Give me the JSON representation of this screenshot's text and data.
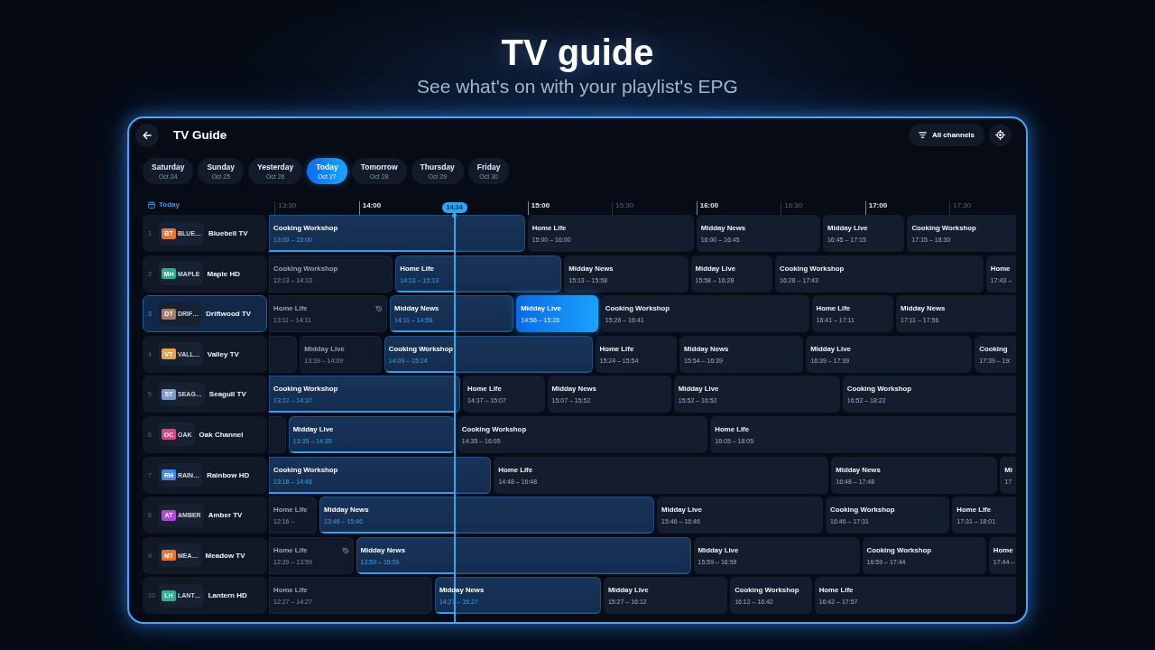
{
  "hero": {
    "title": "TV guide",
    "subtitle": "See what's on with your playlist's EPG"
  },
  "header": {
    "title": "TV Guide",
    "filter_button": "All channels"
  },
  "dates": [
    {
      "day": "Saturday",
      "date": "Oct 24",
      "selected": false
    },
    {
      "day": "Sunday",
      "date": "Oct 25",
      "selected": false
    },
    {
      "day": "Yesterday",
      "date": "Oct 26",
      "selected": false
    },
    {
      "day": "Today",
      "date": "Oct 27",
      "selected": true
    },
    {
      "day": "Tomorrow",
      "date": "Oct 28",
      "selected": false
    },
    {
      "day": "Thursday",
      "date": "Oct 29",
      "selected": false
    },
    {
      "day": "Friday",
      "date": "Oct 30",
      "selected": false
    }
  ],
  "timeline": {
    "day_label": "Today",
    "now": "14:34",
    "ticks": [
      {
        "label": "13:30",
        "kind": "half"
      },
      {
        "label": "14:00",
        "kind": "hour"
      },
      {
        "label": "15:00",
        "kind": "hour"
      },
      {
        "label": "15:30",
        "kind": "half"
      },
      {
        "label": "16:00",
        "kind": "hour"
      },
      {
        "label": "16:30",
        "kind": "half"
      },
      {
        "label": "17:00",
        "kind": "hour"
      },
      {
        "label": "17:30",
        "kind": "half"
      }
    ]
  },
  "channels": [
    {
      "number": "1",
      "logo_initials": "BT",
      "logo_text": "BLUE…",
      "color": "#e8743b",
      "name": "Bluebell TV",
      "selected": false,
      "programs": [
        {
          "title": "Cooking Workshop",
          "time": "13:00 – 15:00",
          "kind": "live",
          "level": 0.725,
          "selected": false,
          "replay": false
        },
        {
          "title": "Home Life",
          "time": "15:00 – 16:00",
          "kind": "upcoming",
          "selected": false,
          "replay": false
        },
        {
          "title": "Midday News",
          "time": "16:00 – 16:45",
          "kind": "upcoming",
          "selected": false,
          "replay": false
        },
        {
          "title": "Midday Live",
          "time": "16:45 – 17:15",
          "kind": "upcoming",
          "selected": false,
          "replay": false
        },
        {
          "title": "Cooking Workshop",
          "time": "17:15 – 18:30",
          "kind": "upcoming",
          "selected": false,
          "replay": false
        }
      ]
    },
    {
      "number": "2",
      "logo_initials": "MH",
      "logo_text": "MAPLE",
      "color": "#2fae84",
      "name": "Maple HD",
      "selected": false,
      "programs": [
        {
          "title": "Cooking Workshop",
          "time": "12:13 – 14:13",
          "kind": "past",
          "selected": false,
          "replay": false
        },
        {
          "title": "Home Life",
          "time": "14:13 – 15:13",
          "kind": "live",
          "level": 0.356,
          "selected": false,
          "replay": false
        },
        {
          "title": "Midday News",
          "time": "15:13 – 15:58",
          "kind": "upcoming",
          "selected": false,
          "replay": false
        },
        {
          "title": "Midday Live",
          "time": "15:58 – 16:28",
          "kind": "upcoming",
          "selected": false,
          "replay": false
        },
        {
          "title": "Cooking Workshop",
          "time": "16:28 – 17:43",
          "kind": "upcoming",
          "selected": false,
          "replay": false
        },
        {
          "title": "Home",
          "time": "17:43 –",
          "kind": "upcoming",
          "selected": false,
          "replay": false
        }
      ]
    },
    {
      "number": "3",
      "logo_initials": "DT",
      "logo_text": "DRIF…",
      "color": "#a27d6a",
      "name": "Driftwood TV",
      "selected": true,
      "programs": [
        {
          "title": "Home Life",
          "time": "13:11 – 14:11",
          "kind": "past",
          "selected": false,
          "replay": true
        },
        {
          "title": "Midday News",
          "time": "14:11 – 14:56",
          "kind": "live",
          "level": 0.522,
          "selected": false,
          "replay": false
        },
        {
          "title": "Midday Live",
          "time": "14:56 – 15:26",
          "kind": "upcoming",
          "selected": true,
          "replay": false
        },
        {
          "title": "Cooking Workshop",
          "time": "15:26 – 16:41",
          "kind": "upcoming",
          "selected": false,
          "replay": false
        },
        {
          "title": "Home Life",
          "time": "16:41 – 17:11",
          "kind": "upcoming",
          "selected": false,
          "replay": false
        },
        {
          "title": "Midday News",
          "time": "17:11 – 17:56",
          "kind": "upcoming",
          "selected": false,
          "replay": false
        }
      ]
    },
    {
      "number": "4",
      "logo_initials": "VT",
      "logo_text": "VALL…",
      "color": "#e3a44a",
      "name": "Valley TV",
      "selected": false,
      "programs": [
        {
          "kind": "past",
          "selected": false,
          "replay": false
        },
        {
          "title": "Midday Live",
          "time": "13:39 – 14:09",
          "kind": "past",
          "selected": false,
          "replay": false
        },
        {
          "title": "Cooking Workshop",
          "time": "14:09 – 15:24",
          "kind": "live",
          "level": 0.338,
          "selected": false,
          "replay": false
        },
        {
          "title": "Home Life",
          "time": "15:24 – 15:54",
          "kind": "upcoming",
          "selected": false,
          "replay": false
        },
        {
          "title": "Midday News",
          "time": "15:54 – 16:39",
          "kind": "upcoming",
          "selected": false,
          "replay": false
        },
        {
          "title": "Midday Live",
          "time": "16:39 – 17:39",
          "kind": "upcoming",
          "selected": false,
          "replay": false
        },
        {
          "title": "Cooking",
          "time": "17:39 – 19:",
          "kind": "upcoming",
          "selected": false,
          "replay": false
        }
      ]
    },
    {
      "number": "5",
      "logo_initials": "ST",
      "logo_text": "SEAG…",
      "color": "#7f9cc8",
      "name": "Seagull TV",
      "selected": false,
      "programs": [
        {
          "title": "Cooking Workshop",
          "time": "13:22 – 14:37",
          "kind": "live",
          "level": 0.97,
          "selected": false,
          "replay": false
        },
        {
          "title": "Home Life",
          "time": "14:37 – 15:07",
          "kind": "upcoming",
          "selected": false,
          "replay": false
        },
        {
          "title": "Midday News",
          "time": "15:07 – 15:52",
          "kind": "upcoming",
          "selected": false,
          "replay": false
        },
        {
          "title": "Midday Live",
          "time": "15:52 – 16:52",
          "kind": "upcoming",
          "selected": false,
          "replay": false
        },
        {
          "title": "Cooking Workshop",
          "time": "16:52 – 18:22",
          "kind": "upcoming",
          "selected": false,
          "replay": false
        }
      ]
    },
    {
      "number": "6",
      "logo_initials": "OC",
      "logo_text": "OAK",
      "color": "#d94682",
      "name": "Oak Channel",
      "selected": false,
      "programs": [
        {
          "kind": "past",
          "selected": false,
          "replay": false
        },
        {
          "title": "Midday Live",
          "time": "13:35 – 14:35",
          "kind": "live",
          "level": 0.99,
          "selected": false,
          "replay": false
        },
        {
          "title": "Cooking Workshop",
          "time": "14:35 – 16:05",
          "kind": "upcoming",
          "selected": false,
          "replay": false
        },
        {
          "title": "Home Life",
          "time": "16:05 – 18:05",
          "kind": "upcoming",
          "selected": false,
          "replay": false
        }
      ]
    },
    {
      "number": "7",
      "logo_initials": "RH",
      "logo_text": "RAIN…",
      "color": "#3d8de6",
      "name": "Rainbow HD",
      "selected": false,
      "programs": [
        {
          "title": "Cooking Workshop",
          "time": "13:18 – 14:48",
          "kind": "live",
          "level": 0.835,
          "selected": false,
          "replay": false
        },
        {
          "title": "Home Life",
          "time": "14:48 – 16:48",
          "kind": "upcoming",
          "selected": false,
          "replay": false
        },
        {
          "title": "Midday News",
          "time": "16:48 – 17:48",
          "kind": "upcoming",
          "selected": false,
          "replay": false
        },
        {
          "title": "Mi",
          "time": "17",
          "kind": "upcoming",
          "selected": false,
          "replay": false
        }
      ]
    },
    {
      "number": "8",
      "logo_initials": "AT",
      "logo_text": "AMBER",
      "color": "#b347d9",
      "name": "Amber TV",
      "selected": false,
      "programs": [
        {
          "title": "Home Life",
          "time": "12:16 –",
          "kind": "past",
          "selected": false,
          "replay": false
        },
        {
          "title": "Midday News",
          "time": "13:46 – 15:46",
          "kind": "live",
          "level": 0.403,
          "selected": false,
          "replay": false
        },
        {
          "title": "Midday Live",
          "time": "15:46 – 16:46",
          "kind": "upcoming",
          "selected": false,
          "replay": false
        },
        {
          "title": "Cooking Workshop",
          "time": "16:46 – 17:31",
          "kind": "upcoming",
          "selected": false,
          "replay": false
        },
        {
          "title": "Home Life",
          "time": "17:31 – 18:01",
          "kind": "upcoming",
          "selected": false,
          "replay": false
        }
      ]
    },
    {
      "number": "9",
      "logo_initials": "MT",
      "logo_text": "MEA…",
      "color": "#e4772e",
      "name": "Meadow TV",
      "selected": false,
      "programs": [
        {
          "title": "Home Life",
          "time": "12:29 – 13:59",
          "kind": "past",
          "selected": false,
          "replay": true
        },
        {
          "title": "Midday News",
          "time": "13:59 – 15:59",
          "kind": "live",
          "level": 0.294,
          "selected": false,
          "replay": false
        },
        {
          "title": "Midday Live",
          "time": "15:59 – 16:59",
          "kind": "upcoming",
          "selected": false,
          "replay": false
        },
        {
          "title": "Cooking Workshop",
          "time": "16:59 – 17:44",
          "kind": "upcoming",
          "selected": false,
          "replay": false
        },
        {
          "title": "Home",
          "time": "17:44 –",
          "kind": "upcoming",
          "selected": false,
          "replay": false
        }
      ]
    },
    {
      "number": "10",
      "logo_initials": "LH",
      "logo_text": "LANT…",
      "color": "#35b08f",
      "name": "Lantern HD",
      "selected": false,
      "programs": [
        {
          "title": "Home Life",
          "time": "12:27 – 14:27",
          "kind": "past",
          "selected": false,
          "replay": false
        },
        {
          "title": "Midday News",
          "time": "14:27 – 15:27",
          "kind": "live",
          "level": 0.118,
          "selected": false,
          "replay": false
        },
        {
          "title": "Midday Live",
          "time": "15:27 – 16:12",
          "kind": "upcoming",
          "selected": false,
          "replay": false
        },
        {
          "title": "Cooking Workshop",
          "time": "16:12 – 16:42",
          "kind": "upcoming",
          "selected": false,
          "replay": false
        },
        {
          "title": "Home Life",
          "time": "16:42 – 17:57",
          "kind": "upcoming",
          "selected": false,
          "replay": false
        }
      ]
    }
  ]
}
